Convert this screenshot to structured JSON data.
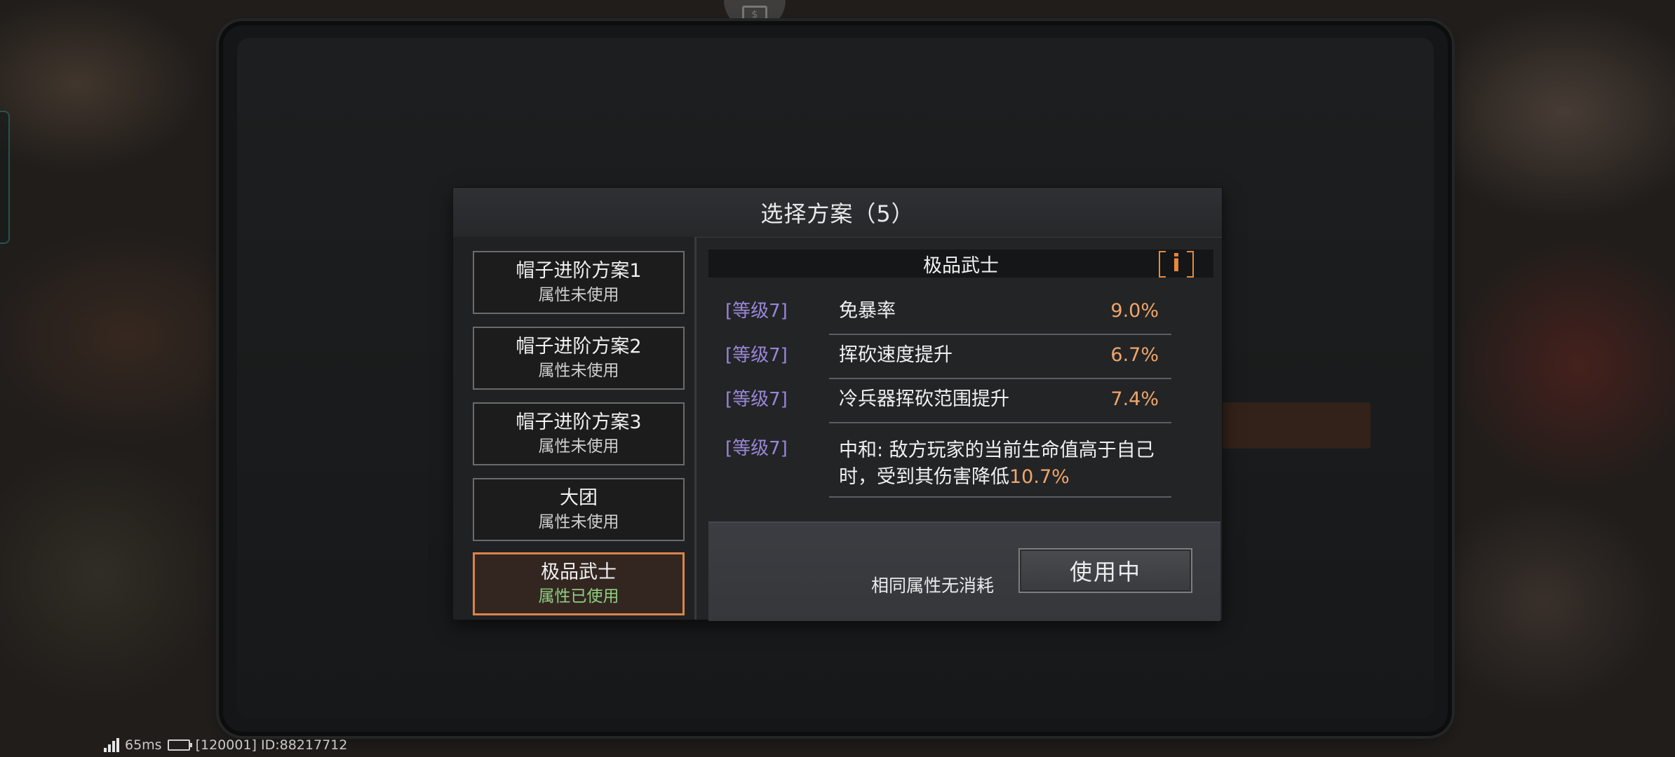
{
  "dialog": {
    "title": "选择方案（5）"
  },
  "plans": [
    {
      "name": "帽子进阶方案1",
      "status": "属性未使用",
      "selected": false
    },
    {
      "name": "帽子进阶方案2",
      "status": "属性未使用",
      "selected": false
    },
    {
      "name": "帽子进阶方案3",
      "status": "属性未使用",
      "selected": false
    },
    {
      "name": "大团",
      "status": "属性未使用",
      "selected": false
    },
    {
      "name": "极品武士",
      "status": "属性已使用",
      "selected": true
    }
  ],
  "detail": {
    "title": "极品武士",
    "info_icon": "info-icon",
    "attributes": [
      {
        "level": "[等级7]",
        "name": "免暴率",
        "value": "9.0%"
      },
      {
        "level": "[等级7]",
        "name": "挥砍速度提升",
        "value": "6.7%"
      },
      {
        "level": "[等级7]",
        "name": "冷兵器挥砍范围提升",
        "value": "7.4%"
      }
    ],
    "special": {
      "level": "[等级7]",
      "text": "中和: 敌方玩家的当前生命值高于自己时，受到其伤害降低",
      "value": "10.7%"
    }
  },
  "footer": {
    "note": "相同属性无消耗",
    "button_label": "使用中"
  },
  "status_bar": {
    "ping": "65ms",
    "server_id": "[120001] ID:88217712"
  },
  "colors": {
    "accent_orange": "#d9854a",
    "level_purple": "#9a86d8",
    "value_orange": "#f0a66a",
    "used_green": "#8fd07f"
  }
}
